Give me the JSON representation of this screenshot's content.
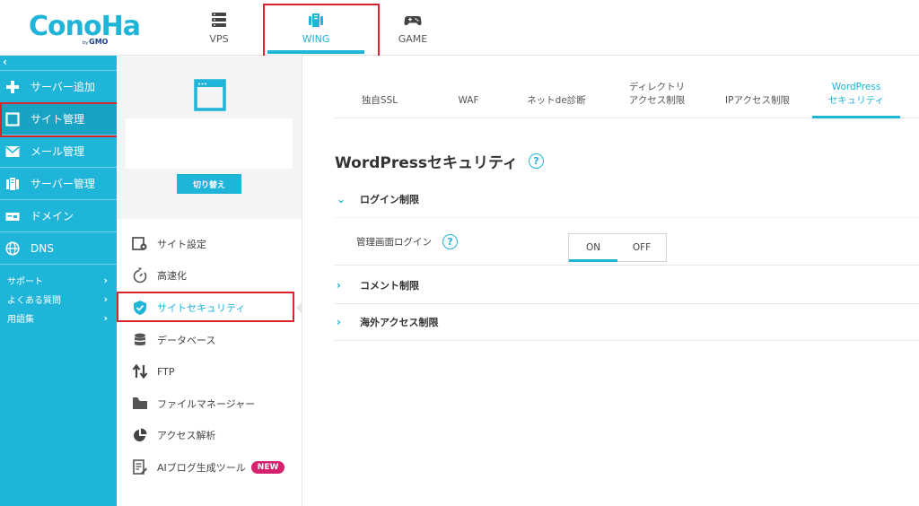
{
  "brand": {
    "logo_text": "ConoHa",
    "logo_by": "by",
    "logo_gmo": "GMO"
  },
  "top_tabs": [
    {
      "label": "VPS",
      "icon": "server-icon"
    },
    {
      "label": "WING",
      "icon": "wing-icon",
      "active": true
    },
    {
      "label": "GAME",
      "icon": "gamepad-icon"
    }
  ],
  "sidebar": {
    "collapse": "‹",
    "items": [
      {
        "label": "サーバー追加",
        "icon": "plus-icon"
      },
      {
        "label": "サイト管理",
        "icon": "window-icon",
        "active": true
      },
      {
        "label": "メール管理",
        "icon": "mail-icon"
      },
      {
        "label": "サーバー管理",
        "icon": "server-manage-icon"
      },
      {
        "label": "ドメイン",
        "icon": "domain-icon"
      },
      {
        "label": "DNS",
        "icon": "globe-icon"
      }
    ],
    "links": [
      {
        "label": "サポート",
        "chevron": "›"
      },
      {
        "label": "よくある質問",
        "chevron": "›"
      },
      {
        "label": "用語集",
        "chevron": "›"
      }
    ]
  },
  "site_panel": {
    "switch_label": "切り替え",
    "menu": [
      {
        "label": "サイト設定",
        "icon": "settings-icon"
      },
      {
        "label": "高速化",
        "icon": "stopwatch-icon"
      },
      {
        "label": "サイトセキュリティ",
        "icon": "shield-check-icon",
        "active": true
      },
      {
        "label": "データベース",
        "icon": "database-icon"
      },
      {
        "label": "FTP",
        "icon": "transfer-arrows-icon"
      },
      {
        "label": "ファイルマネージャー",
        "icon": "folder-icon"
      },
      {
        "label": "アクセス解析",
        "icon": "pie-chart-icon"
      },
      {
        "label": "AIブログ生成ツール",
        "icon": "document-edit-icon",
        "badge": "NEW"
      }
    ]
  },
  "subtabs": [
    {
      "label": "独自SSL"
    },
    {
      "label": "WAF"
    },
    {
      "label": "ネットde診断"
    },
    {
      "label_line1": "ディレクトリ",
      "label_line2": "アクセス制限"
    },
    {
      "label": "IPアクセス制限"
    },
    {
      "label_line1": "WordPress",
      "label_line2": "セキュリティ",
      "active": true
    }
  ],
  "main": {
    "title": "WordPressセキュリティ",
    "help": "?",
    "sections": [
      {
        "title": "ログイン制限",
        "expanded": true,
        "chevron": "⌄"
      },
      {
        "title": "コメント制限",
        "expanded": false,
        "chevron": "›"
      },
      {
        "title": "海外アクセス制限",
        "expanded": false,
        "chevron": "›"
      }
    ],
    "login_row": {
      "label": "管理画面ログイン",
      "help": "?",
      "on": "ON",
      "off": "OFF",
      "selected": "ON"
    }
  },
  "colors": {
    "accent": "#1fb5d9",
    "highlight": "#d9232d",
    "badge": "#d6226e"
  }
}
